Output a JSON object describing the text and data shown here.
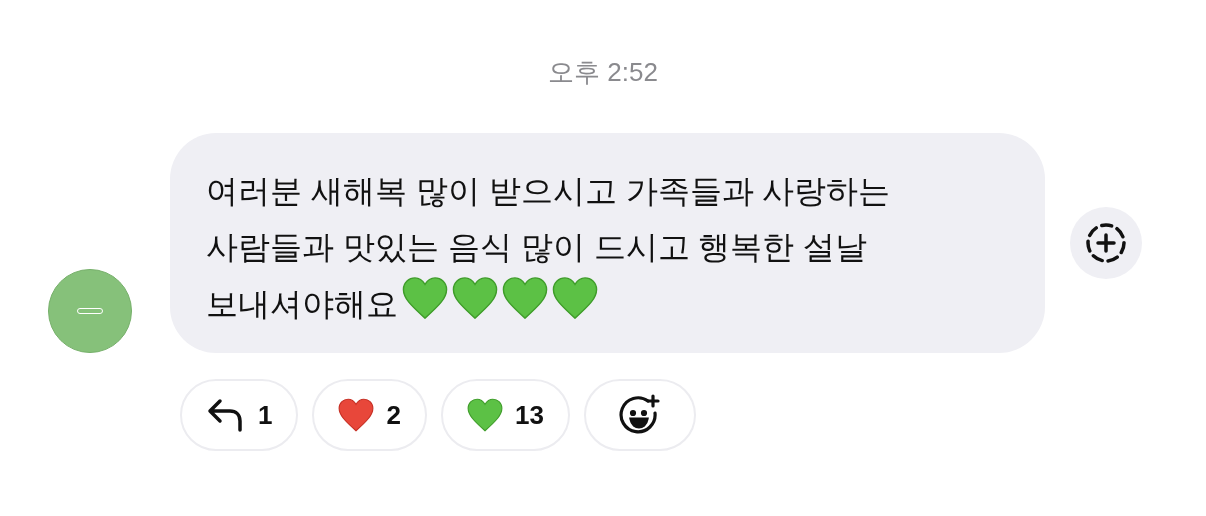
{
  "timestamp": "오후 2:52",
  "message": {
    "text": "여러분 새해복 많이 받으시고 가족들과 사랑하는 사람들과 맛있는 음식 많이 드시고 행복한 설날 보내셔야해요",
    "emoji": [
      {
        "kind": "green_heart"
      },
      {
        "kind": "green_heart"
      },
      {
        "kind": "green_heart"
      },
      {
        "kind": "green_heart"
      }
    ]
  },
  "reactions": [
    {
      "kind": "reply",
      "count": "1"
    },
    {
      "kind": "red_heart",
      "count": "2"
    },
    {
      "kind": "green_heart",
      "count": "13"
    },
    {
      "kind": "add_reaction"
    }
  ]
}
